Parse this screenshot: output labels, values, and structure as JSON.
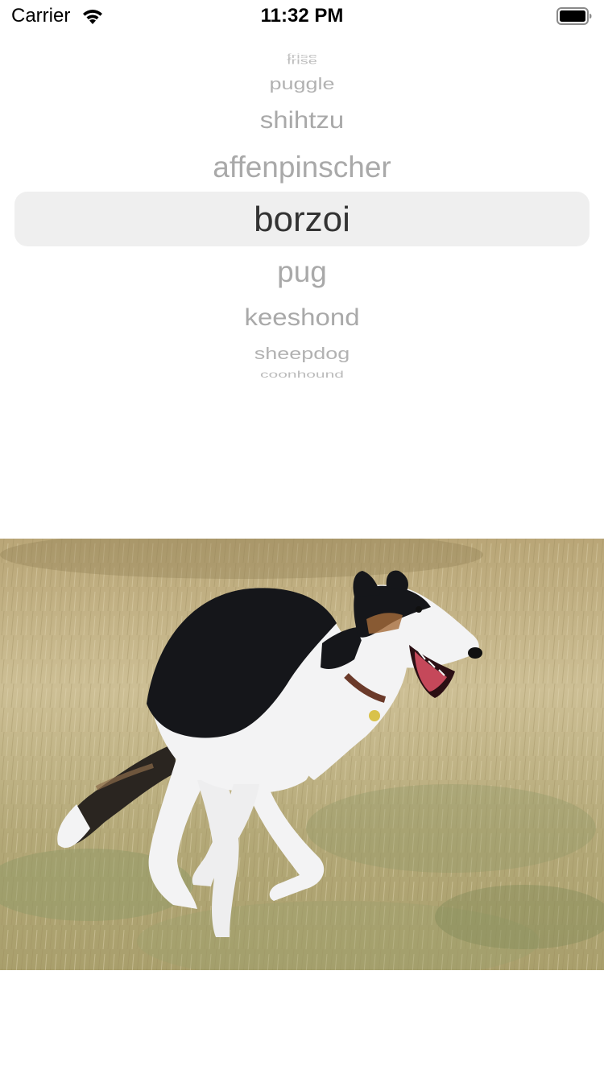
{
  "status_bar": {
    "carrier": "Carrier",
    "time": "11:32 PM",
    "wifi_icon": "wifi-icon",
    "battery_icon": "battery-full-icon"
  },
  "picker": {
    "selected": "borzoi",
    "rows": {
      "far_top": "frise",
      "m4": "frise",
      "m3": "puggle",
      "m2": "shihtzu",
      "m1": "affenpinscher",
      "selected": "borzoi",
      "p1": "pug",
      "p2": "keeshond",
      "p3": "sheepdog",
      "p4": "coonhound"
    }
  },
  "image": {
    "subject_icon": "dog-photo",
    "colors": {
      "grass_light": "#cdbf95",
      "grass_dark": "#8e7d52",
      "grass_green": "#8f9966",
      "dog_black": "#15161a",
      "dog_white": "#f3f3f4"
    }
  }
}
